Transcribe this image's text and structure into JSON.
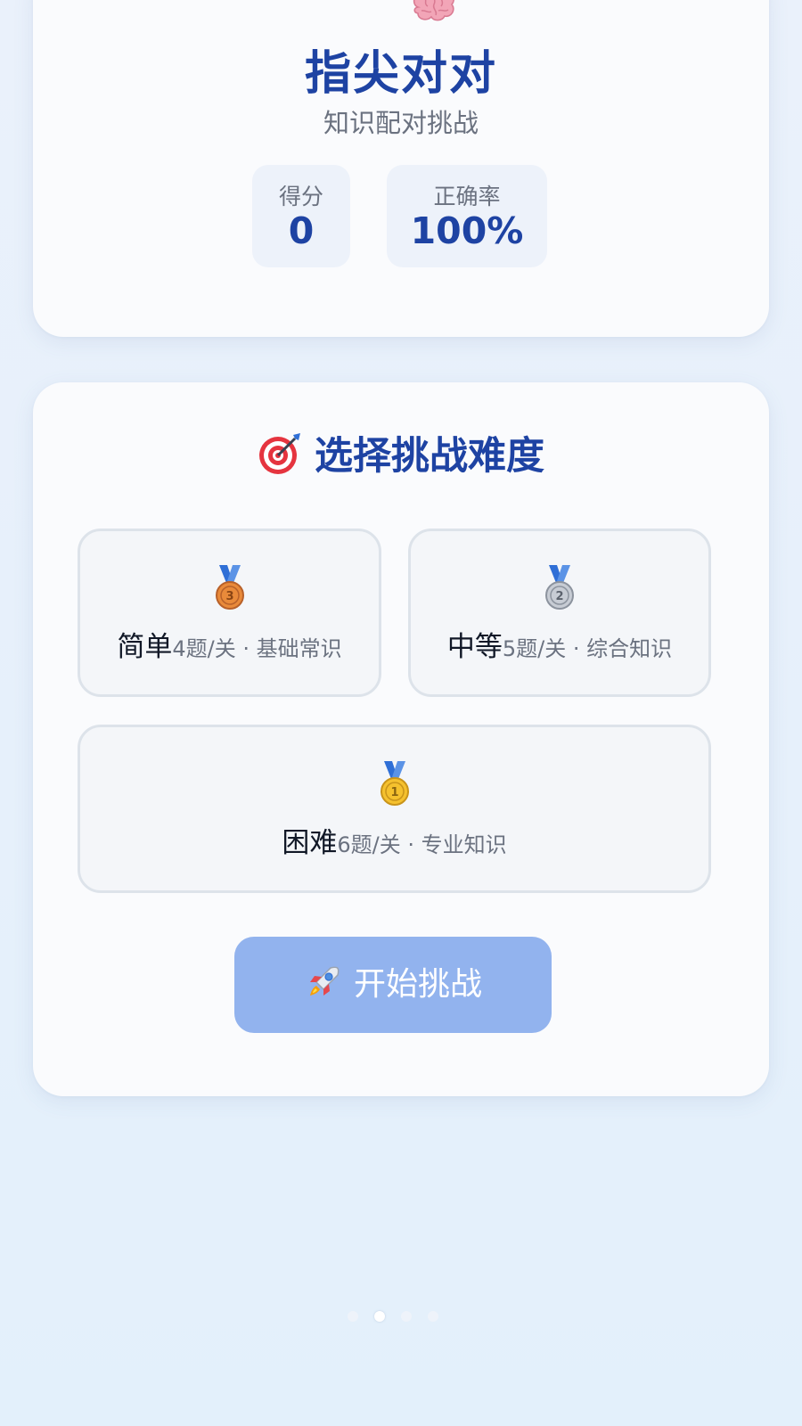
{
  "header": {
    "icon": "brain-icon",
    "title": "指尖对对",
    "subtitle": "知识配对挑战",
    "stats": [
      {
        "label": "得分",
        "value": "0"
      },
      {
        "label": "正确率",
        "value": "100%"
      }
    ]
  },
  "difficulty": {
    "title_icon": "target-icon",
    "title": "选择挑战难度",
    "levels": [
      {
        "medal": "bronze-medal-icon",
        "name": "简单",
        "desc": "4题/关 · 基础常识"
      },
      {
        "medal": "silver-medal-icon",
        "name": "中等",
        "desc": "5题/关 · 综合知识"
      },
      {
        "medal": "gold-medal-icon",
        "name": "困难",
        "desc": "6题/关 · 专业知识"
      }
    ],
    "start_button": {
      "icon": "rocket-icon",
      "label": "开始挑战"
    }
  },
  "pagination": {
    "active_index": 1,
    "count": 4
  },
  "colors": {
    "accent": "#1e43a3",
    "button": "#92b3ee",
    "background": "#e8f1fb"
  }
}
